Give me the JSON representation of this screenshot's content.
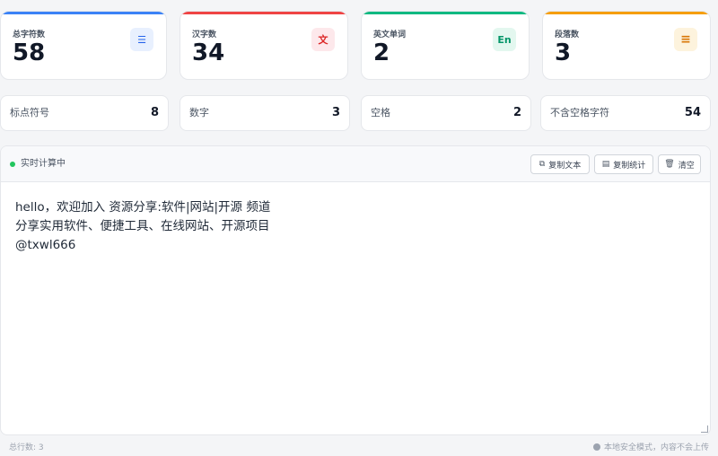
{
  "stats": [
    {
      "label": "总字符数",
      "value": "58",
      "icon": "lines-icon",
      "glyph": "☰",
      "accent": "#3b82f6",
      "icon_bg": "#e8f0fe",
      "icon_color": "#2563eb"
    },
    {
      "label": "汉字数",
      "value": "34",
      "icon": "chinese-char-icon",
      "glyph": "文",
      "accent": "#ef4444",
      "icon_bg": "#fde8eb",
      "icon_color": "#dc2626"
    },
    {
      "label": "英文单词",
      "value": "2",
      "icon": "english-icon",
      "glyph": "En",
      "accent": "#10b981",
      "icon_bg": "#e3f7ef",
      "icon_color": "#059669"
    },
    {
      "label": "段落数",
      "value": "3",
      "icon": "paragraph-icon",
      "glyph": "≡",
      "accent": "#f59e0b",
      "icon_bg": "#fdf3dd",
      "icon_color": "#d97706"
    }
  ],
  "substats": [
    {
      "label": "标点符号",
      "value": "8"
    },
    {
      "label": "数字",
      "value": "3"
    },
    {
      "label": "空格",
      "value": "2"
    },
    {
      "label": "不含空格字符",
      "value": "54"
    }
  ],
  "toolbar": {
    "status": "实时计算中",
    "copy_text": "复制文本",
    "copy_stats": "复制统计",
    "clear": "清空"
  },
  "editor": {
    "content": "hello，欢迎加入 资源分享:软件|网站|开源 频道\n分享实用软件、便捷工具、在线网站、开源项目\n@txwl666"
  },
  "footer": {
    "line_count": "总行数: 3",
    "privacy": "本地安全模式，内容不会上传"
  }
}
